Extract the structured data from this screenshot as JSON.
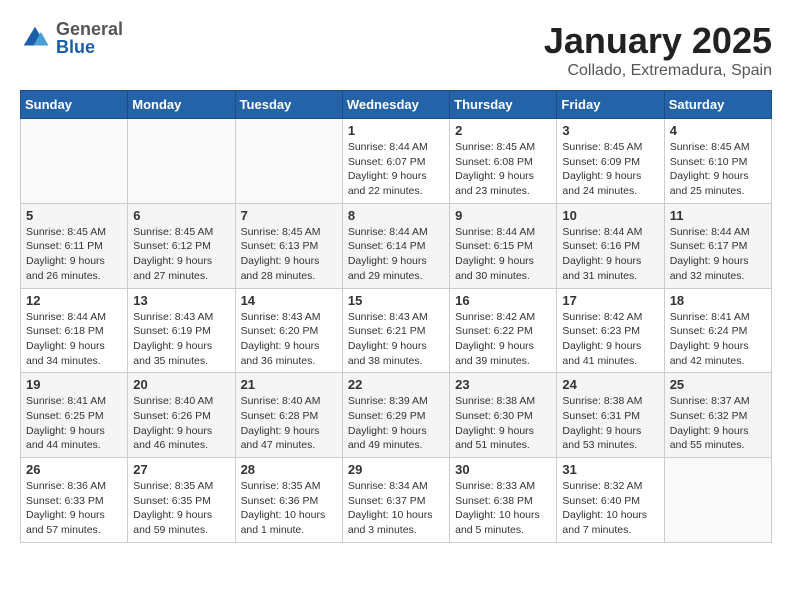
{
  "header": {
    "logo_general": "General",
    "logo_blue": "Blue",
    "month_title": "January 2025",
    "location": "Collado, Extremadura, Spain"
  },
  "weekdays": [
    "Sunday",
    "Monday",
    "Tuesday",
    "Wednesday",
    "Thursday",
    "Friday",
    "Saturday"
  ],
  "weeks": [
    [
      {
        "day": "",
        "info": ""
      },
      {
        "day": "",
        "info": ""
      },
      {
        "day": "",
        "info": ""
      },
      {
        "day": "1",
        "info": "Sunrise: 8:44 AM\nSunset: 6:07 PM\nDaylight: 9 hours\nand 22 minutes."
      },
      {
        "day": "2",
        "info": "Sunrise: 8:45 AM\nSunset: 6:08 PM\nDaylight: 9 hours\nand 23 minutes."
      },
      {
        "day": "3",
        "info": "Sunrise: 8:45 AM\nSunset: 6:09 PM\nDaylight: 9 hours\nand 24 minutes."
      },
      {
        "day": "4",
        "info": "Sunrise: 8:45 AM\nSunset: 6:10 PM\nDaylight: 9 hours\nand 25 minutes."
      }
    ],
    [
      {
        "day": "5",
        "info": "Sunrise: 8:45 AM\nSunset: 6:11 PM\nDaylight: 9 hours\nand 26 minutes."
      },
      {
        "day": "6",
        "info": "Sunrise: 8:45 AM\nSunset: 6:12 PM\nDaylight: 9 hours\nand 27 minutes."
      },
      {
        "day": "7",
        "info": "Sunrise: 8:45 AM\nSunset: 6:13 PM\nDaylight: 9 hours\nand 28 minutes."
      },
      {
        "day": "8",
        "info": "Sunrise: 8:44 AM\nSunset: 6:14 PM\nDaylight: 9 hours\nand 29 minutes."
      },
      {
        "day": "9",
        "info": "Sunrise: 8:44 AM\nSunset: 6:15 PM\nDaylight: 9 hours\nand 30 minutes."
      },
      {
        "day": "10",
        "info": "Sunrise: 8:44 AM\nSunset: 6:16 PM\nDaylight: 9 hours\nand 31 minutes."
      },
      {
        "day": "11",
        "info": "Sunrise: 8:44 AM\nSunset: 6:17 PM\nDaylight: 9 hours\nand 32 minutes."
      }
    ],
    [
      {
        "day": "12",
        "info": "Sunrise: 8:44 AM\nSunset: 6:18 PM\nDaylight: 9 hours\nand 34 minutes."
      },
      {
        "day": "13",
        "info": "Sunrise: 8:43 AM\nSunset: 6:19 PM\nDaylight: 9 hours\nand 35 minutes."
      },
      {
        "day": "14",
        "info": "Sunrise: 8:43 AM\nSunset: 6:20 PM\nDaylight: 9 hours\nand 36 minutes."
      },
      {
        "day": "15",
        "info": "Sunrise: 8:43 AM\nSunset: 6:21 PM\nDaylight: 9 hours\nand 38 minutes."
      },
      {
        "day": "16",
        "info": "Sunrise: 8:42 AM\nSunset: 6:22 PM\nDaylight: 9 hours\nand 39 minutes."
      },
      {
        "day": "17",
        "info": "Sunrise: 8:42 AM\nSunset: 6:23 PM\nDaylight: 9 hours\nand 41 minutes."
      },
      {
        "day": "18",
        "info": "Sunrise: 8:41 AM\nSunset: 6:24 PM\nDaylight: 9 hours\nand 42 minutes."
      }
    ],
    [
      {
        "day": "19",
        "info": "Sunrise: 8:41 AM\nSunset: 6:25 PM\nDaylight: 9 hours\nand 44 minutes."
      },
      {
        "day": "20",
        "info": "Sunrise: 8:40 AM\nSunset: 6:26 PM\nDaylight: 9 hours\nand 46 minutes."
      },
      {
        "day": "21",
        "info": "Sunrise: 8:40 AM\nSunset: 6:28 PM\nDaylight: 9 hours\nand 47 minutes."
      },
      {
        "day": "22",
        "info": "Sunrise: 8:39 AM\nSunset: 6:29 PM\nDaylight: 9 hours\nand 49 minutes."
      },
      {
        "day": "23",
        "info": "Sunrise: 8:38 AM\nSunset: 6:30 PM\nDaylight: 9 hours\nand 51 minutes."
      },
      {
        "day": "24",
        "info": "Sunrise: 8:38 AM\nSunset: 6:31 PM\nDaylight: 9 hours\nand 53 minutes."
      },
      {
        "day": "25",
        "info": "Sunrise: 8:37 AM\nSunset: 6:32 PM\nDaylight: 9 hours\nand 55 minutes."
      }
    ],
    [
      {
        "day": "26",
        "info": "Sunrise: 8:36 AM\nSunset: 6:33 PM\nDaylight: 9 hours\nand 57 minutes."
      },
      {
        "day": "27",
        "info": "Sunrise: 8:35 AM\nSunset: 6:35 PM\nDaylight: 9 hours\nand 59 minutes."
      },
      {
        "day": "28",
        "info": "Sunrise: 8:35 AM\nSunset: 6:36 PM\nDaylight: 10 hours\nand 1 minute."
      },
      {
        "day": "29",
        "info": "Sunrise: 8:34 AM\nSunset: 6:37 PM\nDaylight: 10 hours\nand 3 minutes."
      },
      {
        "day": "30",
        "info": "Sunrise: 8:33 AM\nSunset: 6:38 PM\nDaylight: 10 hours\nand 5 minutes."
      },
      {
        "day": "31",
        "info": "Sunrise: 8:32 AM\nSunset: 6:40 PM\nDaylight: 10 hours\nand 7 minutes."
      },
      {
        "day": "",
        "info": ""
      }
    ]
  ]
}
